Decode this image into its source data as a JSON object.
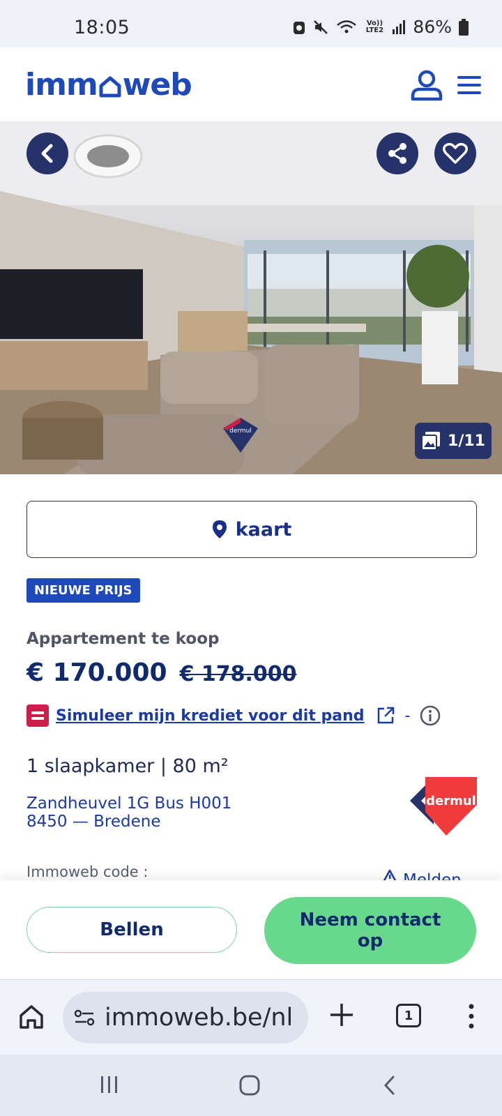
{
  "status_bar": {
    "time": "18:05",
    "battery": "86%",
    "network_label": "Vo)) LTE2"
  },
  "header": {
    "logo_text_left": "imm",
    "logo_text_right": "web"
  },
  "gallery": {
    "counter": "1/11",
    "watermark": "dermul"
  },
  "map_button": {
    "label": "kaart"
  },
  "badge": "NIEUWE PRIJS",
  "listing": {
    "type": "Appartement te koop",
    "price": "€ 170.000",
    "old_price": "€ 178.000",
    "credit_link": "Simuleer mijn krediet voor dit pand",
    "credit_separator": "-",
    "specs": "1 slaapkamer | 80 m²",
    "address_line1": "Zandheuvel 1G Bus H001",
    "address_line2": "8450 — Bredene",
    "code_label": "Immoweb code :",
    "report_label": "Melden",
    "agency_name": "dermul"
  },
  "actions": {
    "call": "Bellen",
    "contact": "Neem contact op"
  },
  "browser": {
    "url": "immoweb.be/nl",
    "tab_count": "1"
  },
  "colors": {
    "brand": "#1e49b8",
    "navy": "#26336a",
    "cta_green": "#68d98c",
    "credit_red": "#cc1e4a"
  }
}
